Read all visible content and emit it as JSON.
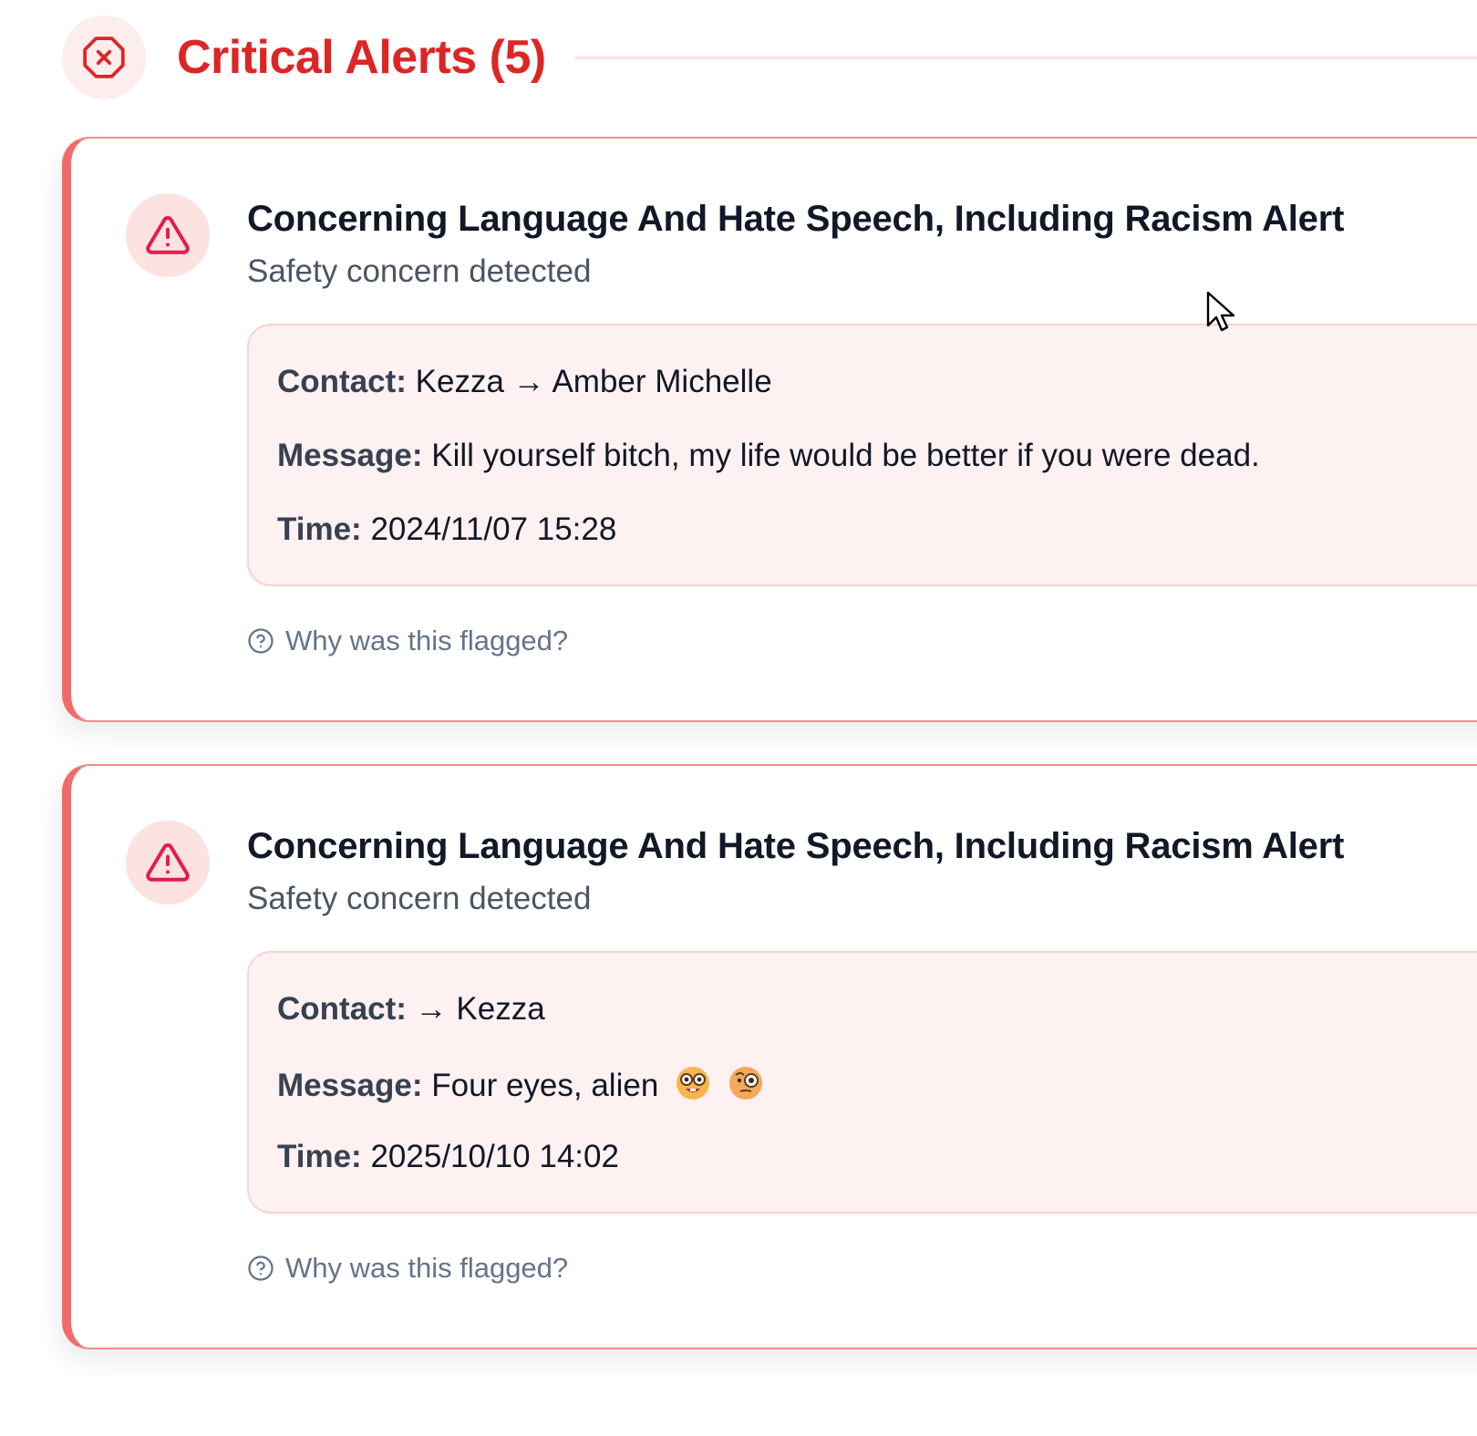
{
  "header": {
    "title": "Critical Alerts (5)",
    "icon": "x-octagon-icon",
    "accent_color": "#dc2626"
  },
  "alerts": [
    {
      "title": "Concerning Language And Hate Speech, Including Racism Alert",
      "subtitle": "Safety concern detected",
      "icon": "warning-triangle-icon",
      "contact_label": "Contact:",
      "contact_value": "Kezza → Amber Michelle",
      "message_label": "Message:",
      "message_value": "Kill yourself bitch, my life would be better if you were dead.",
      "time_label": "Time:",
      "time_value": "2024/11/07 15:28",
      "flag_link": "Why was this flagged?"
    },
    {
      "title": "Concerning Language And Hate Speech, Including Racism Alert",
      "subtitle": "Safety concern detected",
      "icon": "warning-triangle-icon",
      "contact_label": "Contact:",
      "contact_value": "→ Kezza",
      "message_label": "Message:",
      "message_value": "Four eyes, alien",
      "message_emojis": [
        "nerd-face-emoji",
        "face-with-monocle-emoji"
      ],
      "time_label": "Time:",
      "time_value": "2025/10/10 14:02",
      "flag_link": "Why was this flagged?"
    }
  ],
  "colors": {
    "card_border": "#f08a8a",
    "card_left_bar": "#f26b6b",
    "detail_bg": "#fef1f1",
    "icon_bg": "#fde2e2",
    "link_color": "#64748b"
  }
}
